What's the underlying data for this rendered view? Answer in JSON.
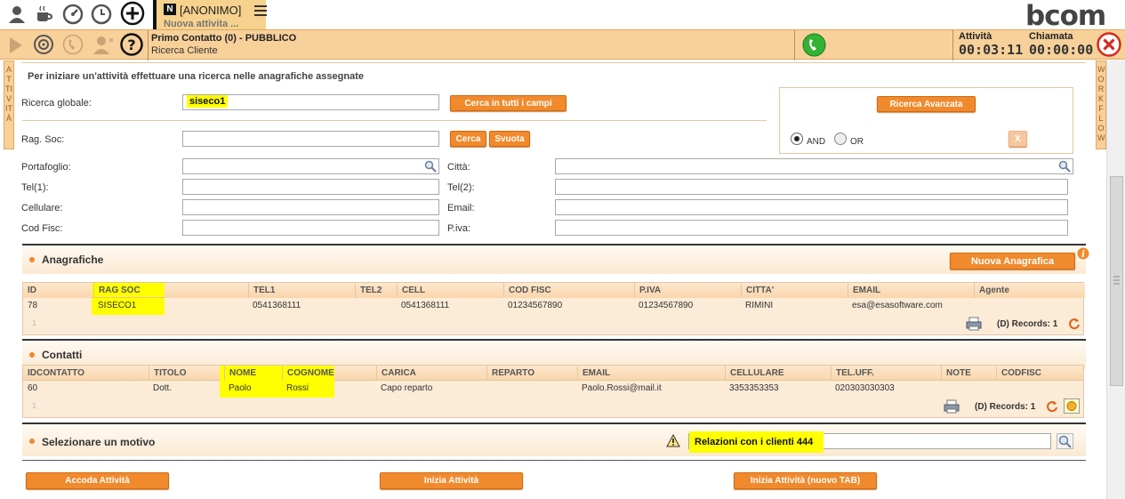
{
  "topbar": {
    "tab_label": "[ANONIMO]",
    "tab_sub": "Nuova attivita ...",
    "logo": "bcom",
    "icons": [
      "user-icon",
      "coffee-icon",
      "speedometer-icon",
      "clock-icon",
      "add-icon",
      "menu-icon"
    ]
  },
  "bar2": {
    "title": "Primo Contatto (0) - PUBBLICO",
    "subtitle": "Ricerca Cliente",
    "timer1_label": "Attività",
    "timer1_value": "00:03:11",
    "timer2_label": "Chiamata",
    "timer2_value": "00:00:00"
  },
  "sidebars": {
    "left": "ATTIVITÀ",
    "right": "WORKFLOW"
  },
  "search": {
    "instructions": "Per iniziare un'attività effettuare una ricerca nelle anagrafiche assegnate",
    "global_label": "Ricerca globale:",
    "global_value": "siseco1",
    "search_all_button": "Cerca in tutti i campi",
    "advanced_button": "Ricerca Avanzata",
    "and_label": "AND",
    "or_label": "OR",
    "clear_x": "X",
    "ragsoc_label": "Rag. Soc:",
    "cerca_button": "Cerca",
    "svuota_button": "Svuota",
    "portafoglio_label": "Portafoglio:",
    "citta_label": "Città:",
    "tel1_label": "Tel(1):",
    "tel2_label": "Tel(2):",
    "cellulare_label": "Cellulare:",
    "email_label": "Email:",
    "codfisc_label": "Cod Fisc:",
    "piva_label": "P.iva:"
  },
  "anagrafiche": {
    "title": "Anagrafiche",
    "new_button": "Nuova Anagrafica",
    "headers": [
      "ID",
      "RAG SOC",
      "TEL1",
      "TEL2",
      "CELL",
      "COD FISC",
      "P.IVA",
      "CITTA'",
      "EMAIL",
      "Agente"
    ],
    "row": [
      "78",
      "SISECO1",
      "0541368111",
      "",
      "0541368111",
      "01234567890",
      "01234567890",
      "RIMINI",
      "esa@esasoftware.com",
      ""
    ],
    "page": "1",
    "records": "(D) Records: 1"
  },
  "contatti": {
    "title": "Contatti",
    "headers": [
      "IDCONTATTO",
      "TITOLO",
      "NOME",
      "COGNOME",
      "CARICA",
      "REPARTO",
      "EMAIL",
      "CELLULARE",
      "TEL.UFF.",
      "NOTE",
      "CODFISC"
    ],
    "row": [
      "60",
      "Dott.",
      "Paolo",
      "Rossi",
      "Capo reparto",
      "",
      "Paolo.Rossi@mail.it",
      "3353353353",
      "020303030303",
      "",
      ""
    ],
    "page": "1",
    "records": "(D) Records: 1"
  },
  "motivo": {
    "title": "Selezionare un motivo",
    "value": "Relazioni con i clienti 444"
  },
  "actions": {
    "accoda": "Accoda Attività",
    "inizia": "Inizia Attività",
    "inizia_tab": "Inizia Attività (nuovo TAB)"
  },
  "colors": {
    "accent": "#f08a2c",
    "bar": "#f7d09a",
    "highlight": "#ffff00"
  }
}
